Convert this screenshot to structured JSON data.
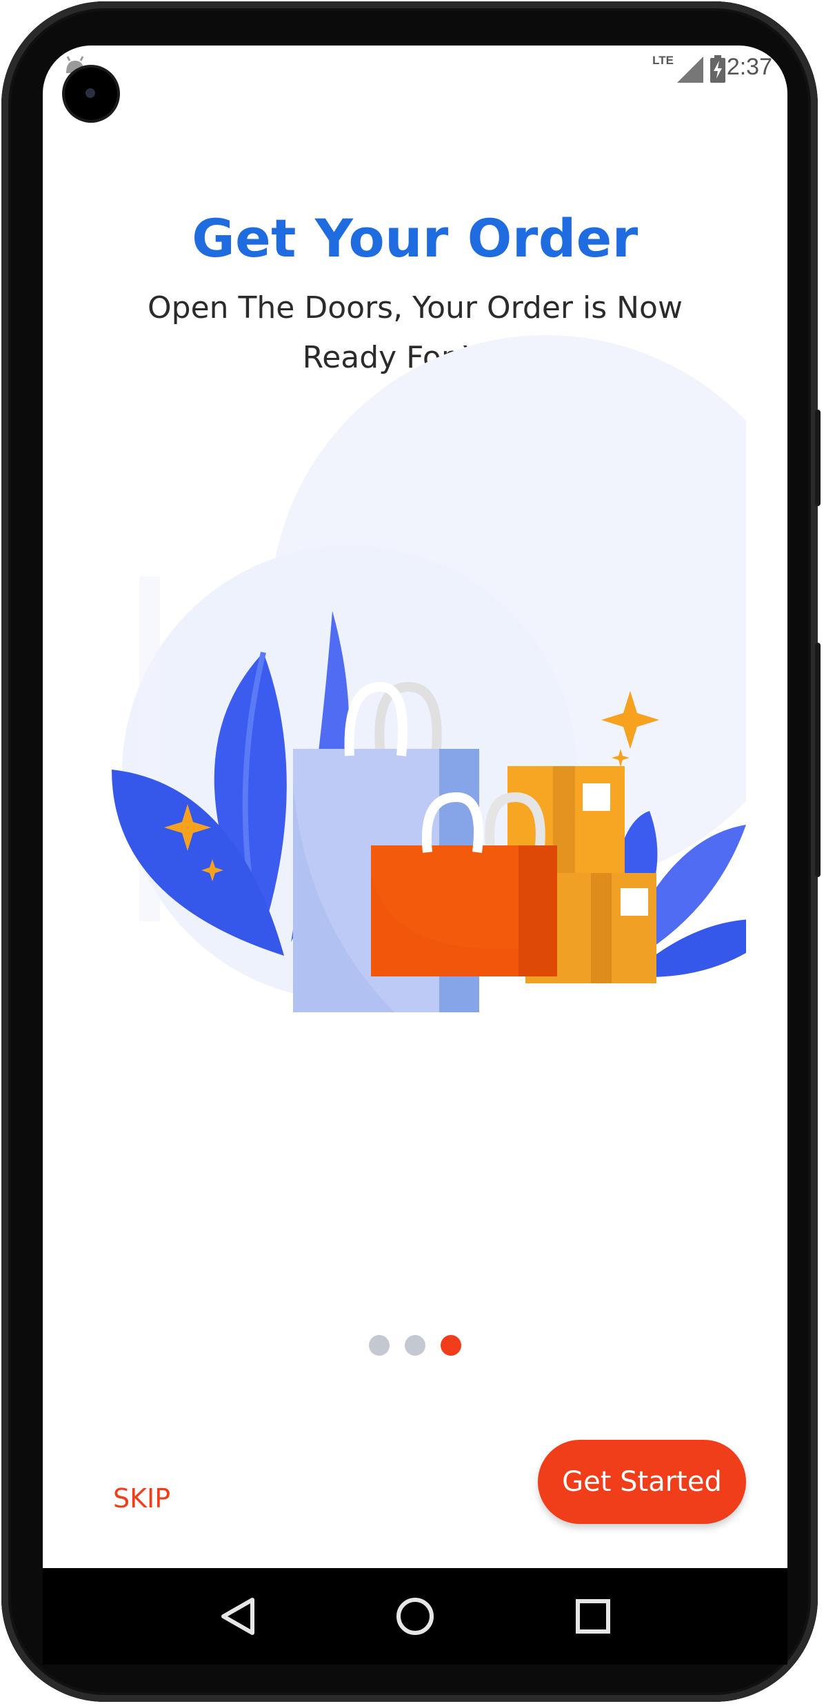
{
  "status_bar": {
    "time": "2:37",
    "network": "LTE"
  },
  "onboarding": {
    "title": "Get Your Order",
    "subtitle": "Open The Doors, Your Order is Now Ready For You!",
    "page_count": 3,
    "active_page": 3
  },
  "actions": {
    "skip_label": "SKIP",
    "get_started_label": "Get Started"
  },
  "colors": {
    "title": "#1f6ce0",
    "accent": "#f03e1b",
    "dot_inactive": "#c3c8d1"
  },
  "icons": {
    "nav_back": "triangle-back-icon",
    "nav_home": "circle-home-icon",
    "nav_recents": "square-recents-icon"
  }
}
